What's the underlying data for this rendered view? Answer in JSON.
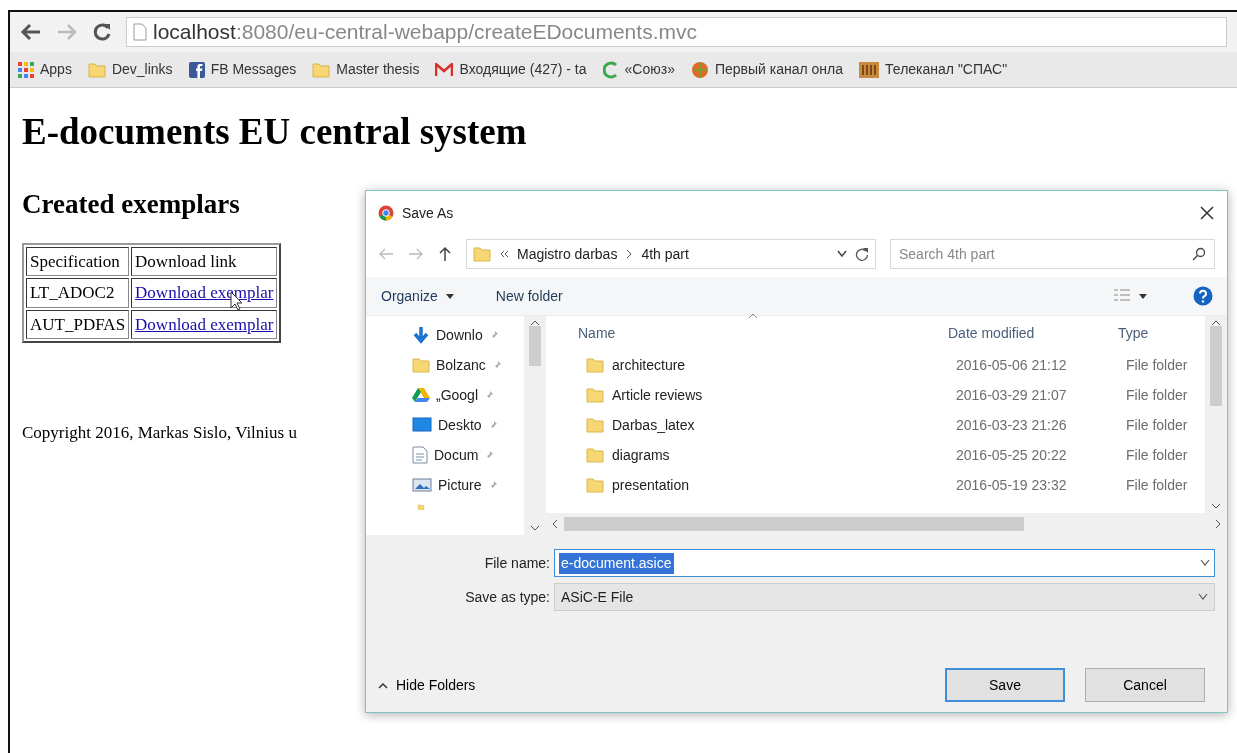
{
  "browser": {
    "url_host": "localhost",
    "url_path": ":8080/eu-central-webapp/createEDocuments.mvc",
    "bookmarks": [
      {
        "label": "Apps",
        "kind": "apps"
      },
      {
        "label": "Dev_links",
        "kind": "folder"
      },
      {
        "label": "FB Messages",
        "kind": "facebook"
      },
      {
        "label": "Master thesis",
        "kind": "folder"
      },
      {
        "label": "Входящие (427) - ta",
        "kind": "mail"
      },
      {
        "label": "«Союз»",
        "kind": "letter"
      },
      {
        "label": "Первый канал онла",
        "kind": "globe"
      },
      {
        "label": "Телеканал \"СПАС\"",
        "kind": "channel"
      }
    ]
  },
  "page": {
    "heading": "E-documents EU central system",
    "subheading": "Created exemplars",
    "table": {
      "columns": [
        "Specification",
        "Download link"
      ],
      "rows": [
        {
          "specification": "LT_ADOC2",
          "link": "Download exemplar"
        },
        {
          "specification": "AUT_PDFAS",
          "link": "Download exemplar"
        }
      ]
    },
    "copyright": "Copyright 2016, Markas Sislo, Vilnius u"
  },
  "dialog": {
    "title": "Save As",
    "breadcrumb": [
      "Magistro darbas",
      "4th part"
    ],
    "search": {
      "placeholder": "Search 4th part"
    },
    "organize": "Organize",
    "new_folder": "New folder",
    "nav_items": [
      {
        "label": "Downlo",
        "kind": "download"
      },
      {
        "label": "Bolzanc",
        "kind": "folder"
      },
      {
        "label": "„Googl",
        "kind": "drive"
      },
      {
        "label": "Deskto",
        "kind": "desktop"
      },
      {
        "label": "Docum",
        "kind": "document"
      },
      {
        "label": "Picture",
        "kind": "pictures"
      }
    ],
    "columns": [
      "Name",
      "Date modified",
      "Type"
    ],
    "files": [
      {
        "name": "architecture",
        "date": "2016-05-06 21:12",
        "type": "File folder"
      },
      {
        "name": "Article reviews",
        "date": "2016-03-29 21:07",
        "type": "File folder"
      },
      {
        "name": "Darbas_latex",
        "date": "2016-03-23 21:26",
        "type": "File folder"
      },
      {
        "name": "diagrams",
        "date": "2016-05-25 20:22",
        "type": "File folder"
      },
      {
        "name": "presentation",
        "date": "2016-05-19 23:32",
        "type": "File folder"
      }
    ],
    "file_name_label": "File name:",
    "file_name": {
      "value": "e-document.asice",
      "selected": true
    },
    "type_label": "Save as type:",
    "type_value": "ASiC-E File",
    "hide_folders": "Hide Folders",
    "save": "Save",
    "cancel": "Cancel"
  }
}
